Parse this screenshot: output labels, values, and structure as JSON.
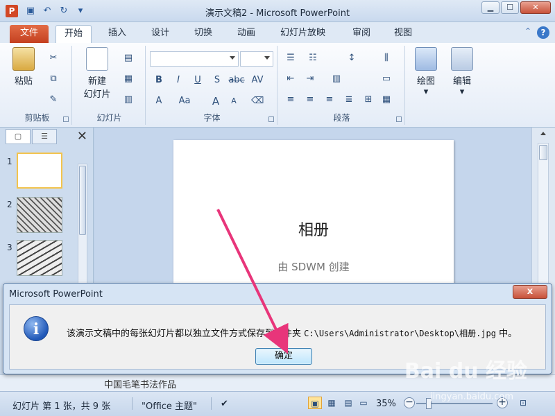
{
  "window": {
    "title": "演示文稿2 - Microsoft PowerPoint",
    "app_icon": "P",
    "min": "▁",
    "max": "☐",
    "close": "✕"
  },
  "qat": {
    "save_icon": "save-icon",
    "undo_icon": "undo-icon",
    "redo_icon": "redo-icon"
  },
  "tabs": [
    {
      "label": "文件"
    },
    {
      "label": "开始"
    },
    {
      "label": "插入"
    },
    {
      "label": "设计"
    },
    {
      "label": "切换"
    },
    {
      "label": "动画"
    },
    {
      "label": "幻灯片放映"
    },
    {
      "label": "审阅"
    },
    {
      "label": "视图"
    }
  ],
  "ribbon": {
    "clipboard": {
      "paste": "粘贴",
      "label": "剪贴板"
    },
    "slides": {
      "new_slide_line1": "新建",
      "new_slide_line2": "幻灯片",
      "label": "幻灯片"
    },
    "font": {
      "label": "字体",
      "bold": "B",
      "italic": "I",
      "underline": "U",
      "strike": "S",
      "abc": "abc",
      "av": "AV",
      "a_color": "A",
      "aa": "Aa",
      "grow": "A",
      "shrink": "A"
    },
    "paragraph": {
      "label": "段落"
    },
    "drawing": {
      "label": "绘图"
    },
    "editing": {
      "label": "编辑"
    }
  },
  "left_pane": {
    "slides": [
      {
        "num": "1"
      },
      {
        "num": "2"
      },
      {
        "num": "3"
      }
    ],
    "close": "✕"
  },
  "slide": {
    "title": "相册",
    "subtitle": "由 SDWM 创建"
  },
  "below_strip": "中国毛笔书法作品",
  "status": {
    "slide_info": "幻灯片 第 1 张，共 9 张",
    "theme": "\"Office 主题\"",
    "zoom": "35%"
  },
  "dialog": {
    "title": "Microsoft PowerPoint",
    "close": "x",
    "message_prefix": "该演示文稿中的每张幻灯片都以独立文件方式保存到文件夹 ",
    "message_path": "C:\\Users\\Administrator\\Desktop\\相册.jpg",
    "message_suffix": " 中。",
    "ok_label": "确定",
    "info_glyph": "i"
  },
  "watermark": {
    "brand": "Bai du 经验",
    "url": "jingyan.baidu.com"
  },
  "colors": {
    "file_tab": "#c44020",
    "arrow": "#e8357a",
    "accent": "#3a78c9"
  }
}
